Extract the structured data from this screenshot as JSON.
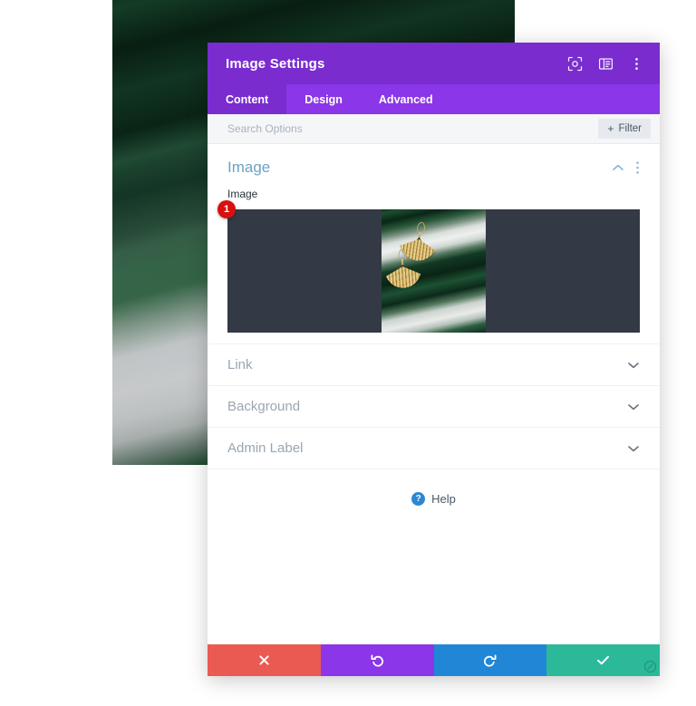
{
  "window": {
    "title": "Image Settings",
    "header_icons": [
      {
        "name": "focus-target-icon",
        "label": "Focus"
      },
      {
        "name": "layout-panel-icon",
        "label": "Panel Layout"
      },
      {
        "name": "more-vertical-icon",
        "label": "More Options"
      }
    ],
    "accent_purple": "#7a2ccf",
    "tabbar_purple": "#8b36e8"
  },
  "tabs": [
    {
      "label": "Content",
      "active": true
    },
    {
      "label": "Design",
      "active": false
    },
    {
      "label": "Advanced",
      "active": false
    }
  ],
  "search": {
    "value": "",
    "placeholder": "Search Options",
    "filter_label": "Filter",
    "filter_plus": "+"
  },
  "image_section": {
    "title": "Image",
    "field_label": "Image",
    "badge": "1",
    "collapse_icon": "chevron-up-icon",
    "menu_icon": "more-vertical-icon",
    "preview_alt": "Gold fan earrings on dark green satin fabric",
    "preview_bg": "#333a45"
  },
  "accordions": [
    {
      "label": "Link",
      "chevron": "chevron-down-icon"
    },
    {
      "label": "Background",
      "chevron": "chevron-down-icon"
    },
    {
      "label": "Admin Label",
      "chevron": "chevron-down-icon"
    }
  ],
  "help": {
    "label": "Help",
    "icon_glyph": "?",
    "icon_color": "#2b87d4"
  },
  "footer": {
    "buttons": [
      {
        "name": "cancel-button",
        "glyph": "✖",
        "color": "#eb5a52",
        "title": "Cancel"
      },
      {
        "name": "undo-button",
        "glyph": "↺",
        "color": "#8b36e8",
        "title": "Undo"
      },
      {
        "name": "redo-button",
        "glyph": "↻",
        "color": "#2186d6",
        "title": "Redo"
      },
      {
        "name": "save-button",
        "glyph": "✔",
        "color": "#2bb99a",
        "title": "Save Changes"
      }
    ]
  }
}
